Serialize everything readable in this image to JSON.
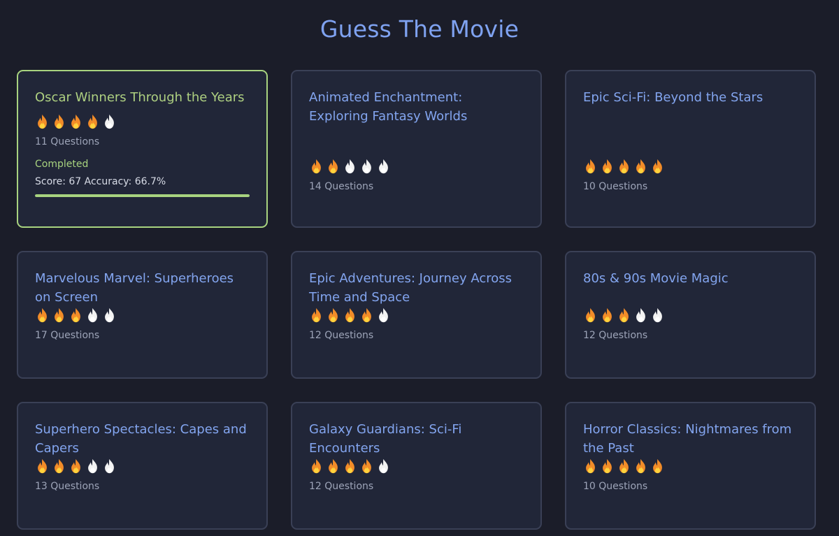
{
  "page": {
    "title": "Guess The Movie"
  },
  "colors": {
    "background": "#1b1d29",
    "card": "#212638",
    "title_blue": "#83a5ef",
    "completed_green": "#a8d37f",
    "flame_active": "#f28c28",
    "flame_inactive": "#f2f2f2"
  },
  "icons": {
    "difficulty": "flame-icon"
  },
  "quizzes": [
    {
      "title": "Oscar Winners Through the Years",
      "difficulty": 4,
      "difficulty_max": 5,
      "questions": "11 Questions",
      "completed": true,
      "status": "Completed",
      "score_text": "Score: 67 Accuracy: 66.7%",
      "progress": 1.0
    },
    {
      "title": "Animated Enchantment: Exploring Fantasy Worlds",
      "difficulty": 2,
      "difficulty_max": 5,
      "questions": "14 Questions",
      "completed": false
    },
    {
      "title": "Epic Sci-Fi: Beyond the Stars",
      "difficulty": 5,
      "difficulty_max": 5,
      "questions": "10 Questions",
      "completed": false
    },
    {
      "title": "Marvelous Marvel: Superheroes on Screen",
      "difficulty": 3,
      "difficulty_max": 5,
      "questions": "17 Questions",
      "completed": false
    },
    {
      "title": "Epic Adventures: Journey Across Time and Space",
      "difficulty": 4,
      "difficulty_max": 5,
      "questions": "12 Questions",
      "completed": false
    },
    {
      "title": "80s & 90s Movie Magic",
      "difficulty": 3,
      "difficulty_max": 5,
      "questions": "12 Questions",
      "completed": false
    },
    {
      "title": "Superhero Spectacles: Capes and Capers",
      "difficulty": 3,
      "difficulty_max": 5,
      "questions": "13 Questions",
      "completed": false
    },
    {
      "title": "Galaxy Guardians: Sci-Fi Encounters",
      "difficulty": 4,
      "difficulty_max": 5,
      "questions": "12 Questions",
      "completed": false
    },
    {
      "title": "Horror Classics: Nightmares from the Past",
      "difficulty": 5,
      "difficulty_max": 5,
      "questions": "10 Questions",
      "completed": false
    }
  ]
}
